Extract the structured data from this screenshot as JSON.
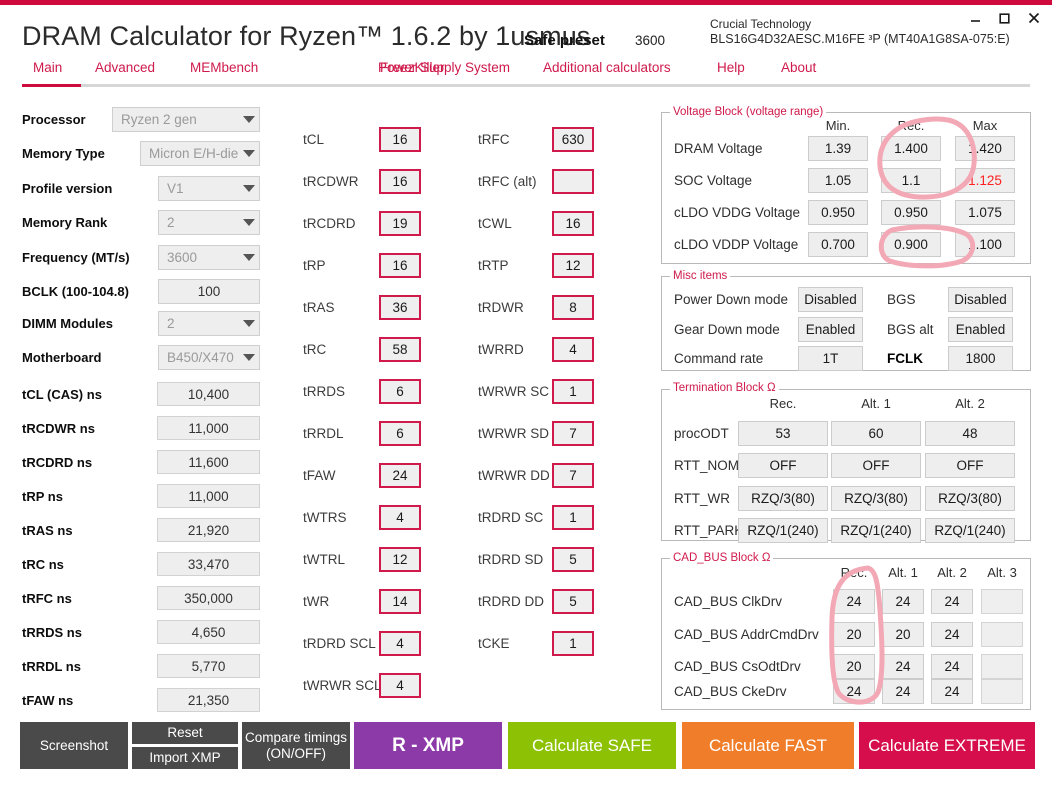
{
  "window": {
    "title": "DRAM Calculator for Ryzen™ 1.6.2 by 1usmus",
    "minimize_icon": "minimize-icon",
    "maximize_icon": "maximize-icon",
    "close_icon": "close-icon",
    "accent_color": "#cf0a3c"
  },
  "header": {
    "preset_label": "Safe preset",
    "preset_frequency": "3600",
    "memory_brand": "Crucial Technology",
    "memory_part": "BLS16G4D32AESC.M16FE ᵌP (MT40A1G8SA-075:E)"
  },
  "tabs": [
    {
      "label": "Main",
      "active": true
    },
    {
      "label": "Advanced",
      "active": false
    },
    {
      "label": "MEMbench",
      "active": false
    },
    {
      "label": "FreezKiller",
      "active": false
    },
    {
      "label": "Power Supply System",
      "active": false
    },
    {
      "label": "Additional calculators",
      "active": false
    },
    {
      "label": "Help",
      "active": false
    },
    {
      "label": "About",
      "active": false
    }
  ],
  "system": {
    "fields": [
      {
        "label": "Processor",
        "value": "Ryzen 2 gen",
        "type": "combo"
      },
      {
        "label": "Memory Type",
        "value": "Micron E/H-die",
        "type": "combo"
      },
      {
        "label": "Profile version",
        "value": "V1",
        "type": "combo"
      },
      {
        "label": "Memory Rank",
        "value": "2",
        "type": "combo"
      },
      {
        "label": "Frequency (MT/s)",
        "value": "3600",
        "type": "combo"
      },
      {
        "label": "BCLK (100-104.8)",
        "value": "100",
        "type": "text"
      },
      {
        "label": "DIMM Modules",
        "value": "2",
        "type": "combo"
      },
      {
        "label": "Motherboard",
        "value": "B450/X470",
        "type": "combo"
      }
    ]
  },
  "ns_values": [
    {
      "label": "tCL (CAS) ns",
      "value": "10,400"
    },
    {
      "label": "tRCDWR ns",
      "value": "11,000"
    },
    {
      "label": "tRCDRD ns",
      "value": "11,600"
    },
    {
      "label": "tRP ns",
      "value": "11,000"
    },
    {
      "label": "tRAS ns",
      "value": "21,920"
    },
    {
      "label": "tRC ns",
      "value": "33,470"
    },
    {
      "label": "tRFC ns",
      "value": "350,000"
    },
    {
      "label": "tRRDS ns",
      "value": "4,650"
    },
    {
      "label": "tRRDL ns",
      "value": "5,770"
    },
    {
      "label": "tFAW ns",
      "value": "21,350"
    }
  ],
  "timings_col1": [
    {
      "label": "tCL",
      "value": "16"
    },
    {
      "label": "tRCDWR",
      "value": "16"
    },
    {
      "label": "tRCDRD",
      "value": "19"
    },
    {
      "label": "tRP",
      "value": "16"
    },
    {
      "label": "tRAS",
      "value": "36"
    },
    {
      "label": "tRC",
      "value": "58"
    },
    {
      "label": "tRRDS",
      "value": "6"
    },
    {
      "label": "tRRDL",
      "value": "6"
    },
    {
      "label": "tFAW",
      "value": "24"
    },
    {
      "label": "tWTRS",
      "value": "4"
    },
    {
      "label": "tWTRL",
      "value": "12"
    },
    {
      "label": "tWR",
      "value": "14"
    },
    {
      "label": "tRDRD SCL",
      "value": "4"
    },
    {
      "label": "tWRWR SCL",
      "value": "4"
    }
  ],
  "timings_col2": [
    {
      "label": "tRFC",
      "value": "630"
    },
    {
      "label": "tRFC (alt)",
      "value": ""
    },
    {
      "label": "tCWL",
      "value": "16"
    },
    {
      "label": "tRTP",
      "value": "12"
    },
    {
      "label": "tRDWR",
      "value": "8"
    },
    {
      "label": "tWRRD",
      "value": "4"
    },
    {
      "label": "tWRWR SC",
      "value": "1"
    },
    {
      "label": "tWRWR SD",
      "value": "7"
    },
    {
      "label": "tWRWR DD",
      "value": "7"
    },
    {
      "label": "tRDRD SC",
      "value": "1"
    },
    {
      "label": "tRDRD SD",
      "value": "5"
    },
    {
      "label": "tRDRD DD",
      "value": "5"
    },
    {
      "label": "tCKE",
      "value": "1"
    }
  ],
  "voltage_block": {
    "title": "Voltage Block (voltage range)",
    "columns": [
      "Min.",
      "Rec.",
      "Max"
    ],
    "rows": [
      {
        "label": "DRAM Voltage",
        "min": "1.39",
        "rec": "1.400",
        "max": "1.420",
        "max_highlight": false
      },
      {
        "label": "SOC Voltage",
        "min": "1.05",
        "rec": "1.1",
        "max": "1.125",
        "max_highlight": true
      },
      {
        "label": "cLDO VDDG Voltage",
        "min": "0.950",
        "rec": "0.950",
        "max": "1.075",
        "max_highlight": false
      },
      {
        "label": "cLDO VDDP Voltage",
        "min": "0.700",
        "rec": "0.900",
        "max": "1.100",
        "max_highlight": false
      }
    ]
  },
  "misc_items": {
    "title": "Misc items",
    "rows": [
      {
        "label_left": "Power Down mode",
        "value_left": "Disabled",
        "label_right": "BGS",
        "value_right": "Disabled",
        "bold_right": false
      },
      {
        "label_left": "Gear Down mode",
        "value_left": "Enabled",
        "label_right": "BGS alt",
        "value_right": "Enabled",
        "bold_right": false
      },
      {
        "label_left": "Command rate",
        "value_left": "1T",
        "label_right": "FCLK",
        "value_right": "1800",
        "bold_right": true
      }
    ]
  },
  "termination_block": {
    "title": "Termination Block Ω",
    "columns": [
      "Rec.",
      "Alt. 1",
      "Alt. 2"
    ],
    "rows": [
      {
        "label": "procODT",
        "values": [
          "53",
          "60",
          "48"
        ]
      },
      {
        "label": "RTT_NOM",
        "values": [
          "OFF",
          "OFF",
          "OFF"
        ]
      },
      {
        "label": "RTT_WR",
        "values": [
          "RZQ/3(80)",
          "RZQ/3(80)",
          "RZQ/3(80)"
        ]
      },
      {
        "label": "RTT_PARK",
        "values": [
          "RZQ/1(240)",
          "RZQ/1(240)",
          "RZQ/1(240)"
        ]
      }
    ]
  },
  "cad_bus_block": {
    "title": "CAD_BUS Block Ω",
    "columns": [
      "Rec.",
      "Alt. 1",
      "Alt. 2",
      "Alt. 3"
    ],
    "rows": [
      {
        "label": "CAD_BUS ClkDrv",
        "values": [
          "24",
          "24",
          "24",
          ""
        ]
      },
      {
        "label": "CAD_BUS AddrCmdDrv",
        "values": [
          "20",
          "20",
          "24",
          ""
        ]
      },
      {
        "label": "CAD_BUS CsOdtDrv",
        "values": [
          "20",
          "24",
          "24",
          ""
        ]
      },
      {
        "label": "CAD_BUS CkeDrv",
        "values": [
          "24",
          "24",
          "24",
          ""
        ]
      }
    ]
  },
  "annotations": {
    "color": "#f2a8b4",
    "marks": [
      {
        "name": "voltage-rec-circle",
        "target": "DRAM/SOC Rec. column"
      },
      {
        "name": "vddp-rec-circle",
        "target": "cLDO VDDP Rec. 0.900"
      },
      {
        "name": "cadbus-rec-circle",
        "target": "CAD_BUS Rec. column"
      }
    ]
  },
  "footer": {
    "screenshot": "Screenshot",
    "reset": "Reset",
    "import_xmp": "Import XMP",
    "compare_line1": "Compare timings",
    "compare_line2": "(ON/OFF)",
    "r_xmp": "R - XMP",
    "calculate_safe": "Calculate SAFE",
    "calculate_fast": "Calculate FAST",
    "calculate_extreme": "Calculate EXTREME"
  }
}
